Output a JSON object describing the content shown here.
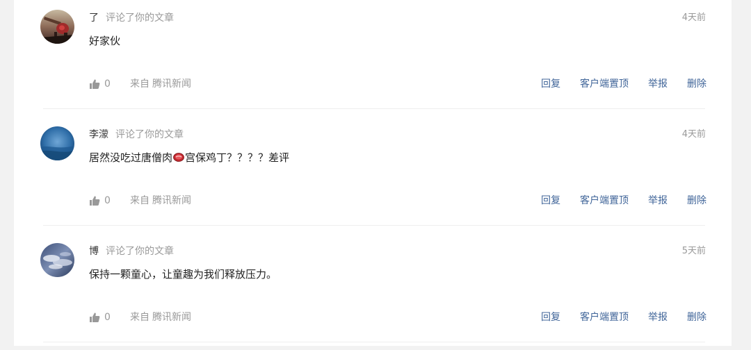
{
  "comments": [
    {
      "user": "了",
      "action": "评论了你的文章",
      "time": "4天前",
      "content_before": "好家伙",
      "content_after": "",
      "has_emoji": false,
      "likes": "0",
      "source_prefix": "来自",
      "source_name": "腾讯新闻",
      "reply": "回复",
      "pin": "客户端置顶",
      "report": "举报",
      "delete": "删除",
      "avatar_icon": "avatar-guitar-icon"
    },
    {
      "user": "李濛",
      "action": "评论了你的文章",
      "time": "4天前",
      "content_before": "居然没吃过唐僧肉",
      "content_after": "宫保鸡丁？？？？差评",
      "has_emoji": true,
      "emoji_icon": "meat-emoji-icon",
      "likes": "0",
      "source_prefix": "来自",
      "source_name": "腾讯新闻",
      "reply": "回复",
      "pin": "客户端置顶",
      "report": "举报",
      "delete": "删除",
      "avatar_icon": "avatar-ocean-icon"
    },
    {
      "user": "博",
      "action": "评论了你的文章",
      "time": "5天前",
      "content_before": "保持一颗童心，让童趣为我们释放压力。",
      "content_after": "",
      "has_emoji": false,
      "likes": "0",
      "source_prefix": "来自",
      "source_name": "腾讯新闻",
      "reply": "回复",
      "pin": "客户端置顶",
      "report": "举报",
      "delete": "删除",
      "avatar_icon": "avatar-clouds-icon"
    }
  ],
  "colors": {
    "link": "#406599",
    "muted": "#999999",
    "text": "#222222",
    "background": "#f2f2f2",
    "panel": "#ffffff"
  }
}
